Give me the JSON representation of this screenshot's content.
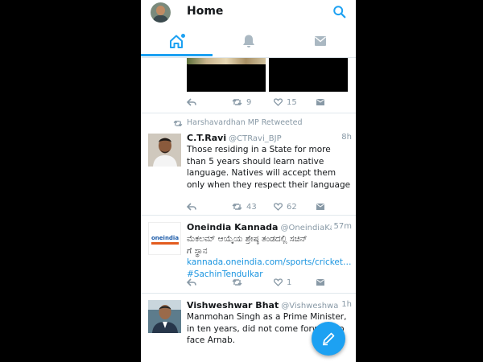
{
  "header": {
    "title": "Home"
  },
  "tabs": [
    {
      "name": "home"
    },
    {
      "name": "notifications"
    },
    {
      "name": "messages"
    }
  ],
  "previous_tweet": {
    "actions": {
      "retweets": "9",
      "likes": "15"
    }
  },
  "tweets": [
    {
      "retweeted_by": "Harshavardhan MP Retweeted",
      "name": "C.T.Ravi",
      "handle": "@CTRavi_BJP",
      "time": "8h",
      "text": "Those residing in a State for more than 5 years should learn native language. Natives will accept them only when they respect their language",
      "actions": {
        "retweets": "43",
        "likes": "62"
      }
    },
    {
      "name": "Oneindia Kannada",
      "handle": "@OneindiaKan...",
      "time": "57m",
      "text_line1": "ಮೆಕಲಮ್ ಆಯ್ಕೆಯ ಶ್ರೇಷ್ಠ ತಂಡದಲ್ಲಿ ಸಚಿನ್",
      "text_line2_prefix": "ಗೆ ಸ್ಥಾನ ",
      "text_link": "kannada.oneindia.com/sports/cricket…",
      "text_hashtag": " #SachinTendulkar",
      "avatar_label": "oneindia",
      "actions": {
        "retweets": "",
        "likes": "1"
      }
    },
    {
      "name": "Vishweshwar Bhat",
      "handle": "@VishweshwarB...",
      "time": "1h",
      "text": "Manmohan Singh as a Prime Minister, in ten years, did not come forward to face Arnab."
    }
  ],
  "colors": {
    "accent": "#1da1f2",
    "text": "#14171a",
    "muted": "#8899a6",
    "link": "#1b95e0"
  }
}
